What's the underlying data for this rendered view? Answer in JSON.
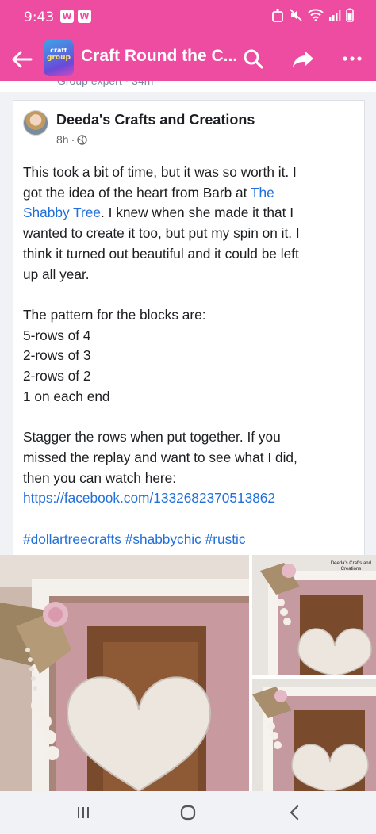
{
  "status_bar": {
    "time": "9:43",
    "badges": [
      "W",
      "W"
    ]
  },
  "header": {
    "title": "Craft Round the C...",
    "group_thumb_text": [
      "craft",
      "group"
    ]
  },
  "previous_post_meta": "Group expert · 34m",
  "post": {
    "author": "Deeda's Crafts and Creations",
    "time": "8h",
    "lines": [
      "This took a bit of time, but it was so worth it. I",
      "got the idea of the heart from Barb at ",
      "Shabby Tree. I knew when she made it that I",
      "wanted to create it too, but put my spin on it. I",
      "think it turned out beautiful and it could be left",
      "up all year.",
      "",
      "The pattern for the blocks are:",
      "5-rows of 4",
      "2-rows of 3",
      "2-rows of 2",
      "1 on each end",
      "",
      "Stagger the rows when put together. If you",
      "missed the replay and want to see what I did,",
      "then you can watch here:"
    ],
    "mention_part1": "The",
    "mention_part2": "The Shabby Tree",
    "url": "https://facebook.com/1332682370513862",
    "hashtags": [
      "#dollartreecrafts",
      "#shabbychic",
      "#rustic"
    ]
  },
  "photo_watermark": [
    "Deeda's Crafts and",
    "Creations"
  ],
  "colors": {
    "accent_pink": "#ee4ca0",
    "link_blue": "#216fdb"
  },
  "icons": [
    "back-arrow-icon",
    "search-icon",
    "share-icon",
    "more-icon",
    "globe-icon",
    "recent-apps-icon",
    "home-icon",
    "back-nav-icon"
  ]
}
